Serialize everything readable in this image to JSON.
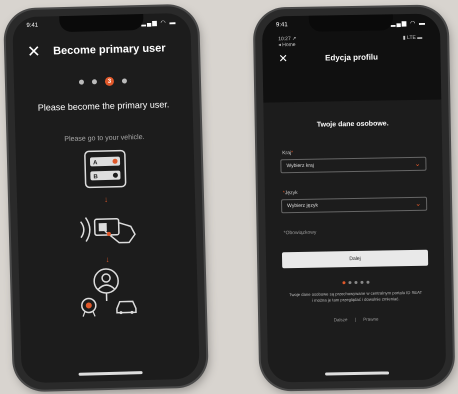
{
  "phone1": {
    "status_time": "9:41",
    "status_icons": "▂▄▆ ◠ ▬",
    "header": {
      "close_icon": "✕",
      "title": "Become primary user"
    },
    "steps": {
      "active_label": "3"
    },
    "heading": "Please become the primary user.",
    "subheading": "Please go to your vehicle.",
    "card": {
      "label_a": "A",
      "label_b": "B"
    }
  },
  "phone2": {
    "status_time": "9:41",
    "status_icons": "▂▄▆ ◠ ▬",
    "top_time": "10:27 ↗",
    "top_back": "◂ Home",
    "top_indicators": "▮ LTE ▬",
    "header": {
      "close_icon": "✕",
      "title": "Edycja profilu"
    },
    "section_heading": "Twoje dane osobowe.",
    "field_country": {
      "label": "Kraj",
      "value": "Wybierz kraj"
    },
    "field_language": {
      "label": "Język",
      "value": "Wybierz język"
    },
    "required_mark": "*",
    "required_note": "*Obowiązkowy",
    "button_label": "Dalej",
    "info_text": "Twoje dane osobowe są przechowywane w centralnym portalu ID SEAT i można je tam przeglądać i dowolnie zmieniać.",
    "links": {
      "left": "Dalsze",
      "sep": "|",
      "right": "Prawne"
    }
  },
  "colors": {
    "accent": "#e0582a",
    "screen": "#1c1c1c"
  }
}
